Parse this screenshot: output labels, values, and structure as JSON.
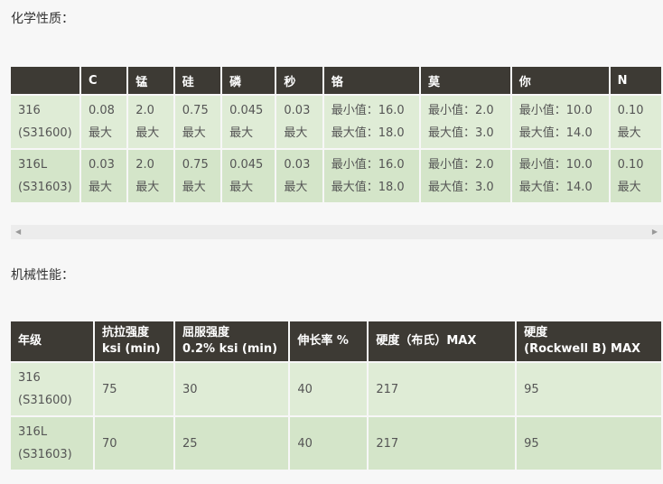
{
  "headings": {
    "chemical": "化学性质：",
    "mechanical": "机械性能："
  },
  "chemical": {
    "headers": [
      "",
      "C",
      "锰",
      "硅",
      "磷",
      "秒",
      "铬",
      "莫",
      "你",
      "N"
    ],
    "rows": [
      [
        "316\n(S31600)",
        "0.08\n最大",
        "2.0\n最大",
        "0.75\n最大",
        "0.045\n最大",
        "0.03\n最大",
        "最小值：16.0\n最大值：18.0",
        "最小值：2.0\n最大值：3.0",
        "最小值：10.0\n最大值：14.0",
        "0.10\n最大"
      ],
      [
        "316L\n(S31603)",
        "0.03\n最大",
        "2.0\n最大",
        "0.75\n最大",
        "0.045\n最大",
        "0.03\n最大",
        "最小值：16.0\n最大值：18.0",
        "最小值：2.0\n最大值：3.0",
        "最小值：10.0\n最大值：14.0",
        "0.10\n最大"
      ]
    ]
  },
  "scrollbar": {
    "left_arrow": "◀",
    "right_arrow": "▶"
  },
  "mechanical": {
    "headers": [
      "年级",
      "抗拉强度\nksi (min)",
      "屈服强度\n0.2% ksi (min)",
      "伸长率 %",
      "硬度（布氏）MAX",
      "硬度\n(Rockwell B) MAX"
    ],
    "rows": [
      [
        "316\n(S31600)",
        "75",
        "30",
        "40",
        "217",
        "95"
      ],
      [
        "316L\n(S31603)",
        "70",
        "25",
        "40",
        "217",
        "95"
      ]
    ]
  }
}
